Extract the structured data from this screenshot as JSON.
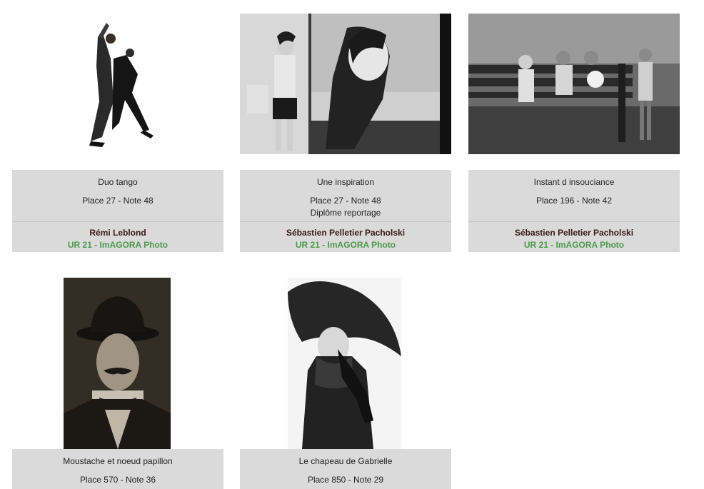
{
  "entries": [
    {
      "title": "Duo tango",
      "place": "Place 27 - Note 48",
      "award": "",
      "author": "Rémi Leblond",
      "club": "UR 21 - ImAGORA Photo"
    },
    {
      "title": "Une inspiration",
      "place": "Place 27 - Note 48",
      "award": "Diplôme reportage",
      "author": "Sébastien Pelletier Pacholski",
      "club": "UR 21 - ImAGORA Photo"
    },
    {
      "title": "Instant d insouciance",
      "place": "Place 196 - Note 42",
      "award": "",
      "author": "Sébastien Pelletier Pacholski",
      "club": "UR 21 - ImAGORA Photo"
    },
    {
      "title": "Moustache et noeud papillon",
      "place": "Place 570 - Note 36",
      "award": ""
    },
    {
      "title": "Le chapeau de Gabrielle",
      "place": "Place 850 - Note 29",
      "award": ""
    }
  ]
}
